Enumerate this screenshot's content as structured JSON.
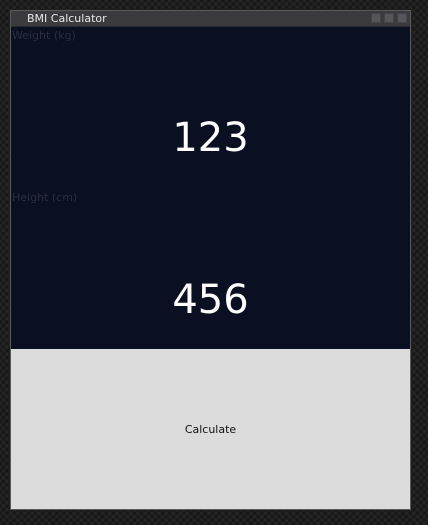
{
  "window": {
    "title": "BMI Calculator"
  },
  "weight": {
    "label": "Weight (kg)",
    "value": "123"
  },
  "height": {
    "label": "Height (cm)",
    "value": "456"
  },
  "actions": {
    "calculate_label": "Calculate"
  }
}
